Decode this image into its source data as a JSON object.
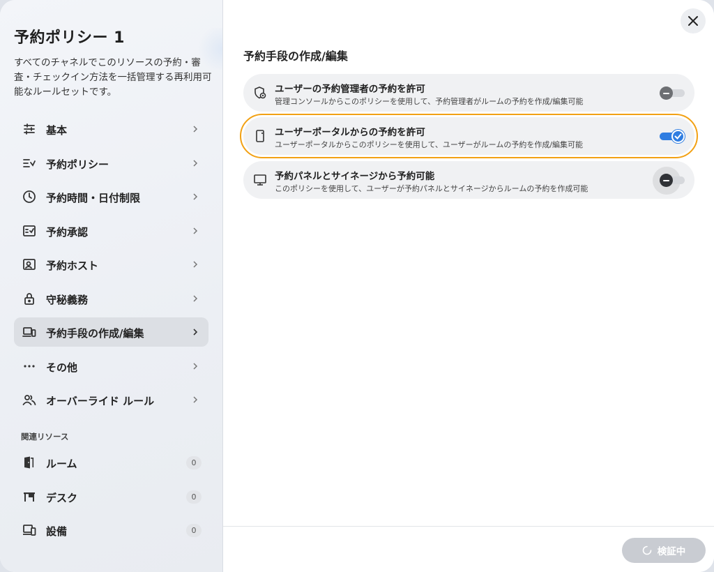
{
  "sidebar": {
    "title": "予約ポリシー 1",
    "description": "すべてのチャネルでこのリソースの予約・審査・チェックイン方法を一括管理する再利用可能なルールセットです。",
    "items": [
      {
        "label": "基本",
        "icon": "sliders-icon"
      },
      {
        "label": "予約ポリシー",
        "icon": "checklist-icon"
      },
      {
        "label": "予約時間・日付制限",
        "icon": "clock-icon"
      },
      {
        "label": "予約承認",
        "icon": "approval-icon"
      },
      {
        "label": "予約ホスト",
        "icon": "host-icon"
      },
      {
        "label": "守秘義務",
        "icon": "lock-icon"
      },
      {
        "label": "予約手段の作成/編集",
        "icon": "devices-icon",
        "active": true
      },
      {
        "label": "その他",
        "icon": "more-icon"
      },
      {
        "label": "オーバーライド ルール",
        "icon": "users-icon"
      }
    ],
    "related_heading": "関連リソース",
    "resources": [
      {
        "label": "ルーム",
        "count": "0",
        "icon": "door-icon"
      },
      {
        "label": "デスク",
        "count": "0",
        "icon": "desk-icon"
      },
      {
        "label": "設備",
        "count": "0",
        "icon": "equipment-icon"
      }
    ]
  },
  "main": {
    "section_title": "予約手段の作成/編集",
    "options": [
      {
        "title": "ユーザーの予約管理者の予約を許可",
        "description": "管理コンソールからこのポリシーを使用して、予約管理者がルームの予約を作成/編集可能",
        "enabled": false,
        "icon": "admin-shield-icon"
      },
      {
        "title": "ユーザーポータルからの予約を許可",
        "description": "ユーザーポータルからこのポリシーを使用して、ユーザーがルームの予約を作成/編集可能",
        "enabled": true,
        "icon": "phone-icon"
      },
      {
        "title": "予約パネルとサイネージから予約可能",
        "description": "このポリシーを使用して、ユーザーが予約パネルとサイネージからルームの予約を作成可能",
        "enabled": false,
        "icon": "monitor-icon"
      }
    ],
    "verify_button": "検証中"
  },
  "colors": {
    "accent": "#2f7de1",
    "focus_outline": "#f2a114"
  }
}
